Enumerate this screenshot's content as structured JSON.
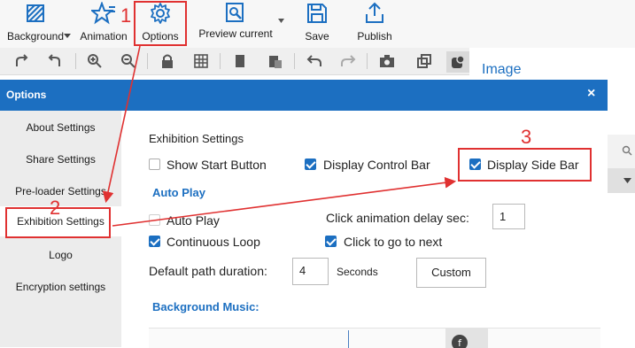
{
  "ribbon": {
    "background": "Background",
    "animation": "Animation",
    "options": "Options",
    "preview": "Preview current",
    "save": "Save",
    "publish": "Publish"
  },
  "right_panel": {
    "title": "Image"
  },
  "dialog": {
    "title": "Options",
    "close": "×",
    "sidebar": [
      {
        "label": "About Settings"
      },
      {
        "label": "Share Settings"
      },
      {
        "label": "Pre-loader Settings"
      },
      {
        "label": "Exhibition Settings"
      },
      {
        "label": "Logo"
      },
      {
        "label": "Encryption settings"
      }
    ],
    "exhibition": {
      "heading": "Exhibition Settings",
      "show_start_button": "Show Start Button",
      "display_control_bar": "Display Control Bar",
      "display_side_bar": "Display Side Bar",
      "autoplay_heading": "Auto Play",
      "auto_play": "Auto Play",
      "click_delay_label": "Click animation delay sec:",
      "click_delay_value": "1",
      "continuous_loop": "Continuous Loop",
      "click_to_next": "Click to go to next",
      "path_duration_label": "Default path duration:",
      "path_duration_value": "4",
      "seconds": "Seconds",
      "custom_button": "Custom",
      "music_heading": "Background Music:"
    },
    "checkboxes": {
      "show_start_button": false,
      "display_control_bar": true,
      "display_side_bar": true,
      "auto_play": false,
      "continuous_loop": true,
      "click_to_next": true
    }
  },
  "annotations": {
    "step1": "1",
    "step2": "2",
    "step3": "3"
  },
  "colors": {
    "accent": "#1c6fc1",
    "annotation": "#e03131"
  }
}
